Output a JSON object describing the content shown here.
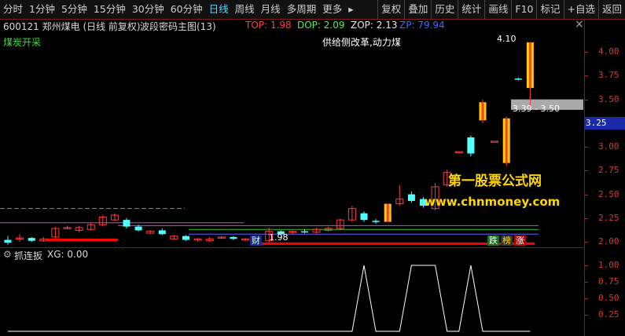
{
  "toolbar": {
    "periods": [
      "分时",
      "1分钟",
      "5分钟",
      "15分钟",
      "30分钟",
      "60分钟",
      "日线",
      "周线",
      "月线",
      "多周期",
      "更多"
    ],
    "active_period": "日线",
    "more_arrow": "▸",
    "actions": [
      "复权",
      "叠加",
      "历史",
      "统计",
      "画线",
      "F10",
      "标记",
      "+自选",
      "返回"
    ]
  },
  "header": {
    "stock": "600121 郑州煤电 (日线 前复权)",
    "indicator": "波段密码主图(13)",
    "top": "TOP: 1.98",
    "dop": "DOP: 2.09",
    "zop": "ZOP: 2.13",
    "zp": "ZP: 79.94"
  },
  "annotations": {
    "sector": "煤炭开采",
    "concept": "供给侧改革,动力煤",
    "high_label": "4.10",
    "low_label": "1.98",
    "range_label": "3.39 - 3.50",
    "cai_badge": "财",
    "die_badge": "跌",
    "bang_badge": "榜",
    "zhang_badge": "涨"
  },
  "watermark": {
    "line1": "第一股票公式网",
    "line2": "www.chnmoney.com"
  },
  "right_axis": {
    "ticks": [
      "4.00",
      "3.75",
      "3.50",
      "3.25",
      "3.00",
      "2.75",
      "2.50",
      "2.25",
      "2.00"
    ],
    "price_tag": "3.25"
  },
  "subchart": {
    "title": "抓连扳",
    "xg": "XG: 0.00",
    "ticks": [
      "1.00",
      "0.75",
      "0.50",
      "0.25"
    ]
  },
  "colors": {
    "up": "#ff3b3b",
    "down": "#54ffff",
    "limit_up": "#ffcc00",
    "support": "#ff0000"
  },
  "chart_data": {
    "type": "candlestick",
    "ylim": [
      1.95,
      4.2
    ],
    "candles": [
      [
        2.02,
        1.99,
        2.06,
        1.97
      ],
      [
        2.03,
        2.04,
        2.08,
        2.0
      ],
      [
        2.04,
        2.01,
        2.05,
        2.0
      ],
      [
        2.01,
        2.03,
        2.05,
        2.0
      ],
      [
        2.05,
        2.14,
        2.16,
        2.03
      ],
      [
        2.14,
        2.15,
        2.17,
        2.13
      ],
      [
        2.12,
        2.15,
        2.17,
        2.1
      ],
      [
        2.13,
        2.18,
        2.2,
        2.12
      ],
      [
        2.18,
        2.26,
        2.28,
        2.16
      ],
      [
        2.23,
        2.28,
        2.3,
        2.22
      ],
      [
        2.23,
        2.16,
        2.25,
        2.14
      ],
      [
        2.16,
        2.12,
        2.18,
        2.11
      ],
      [
        2.09,
        2.11,
        2.12,
        2.08
      ],
      [
        2.12,
        2.08,
        2.14,
        2.07
      ],
      [
        2.03,
        2.06,
        2.07,
        2.02
      ],
      [
        2.06,
        2.02,
        2.07,
        2.01
      ],
      [
        2.02,
        2.03,
        2.04,
        2.0
      ],
      [
        2.01,
        2.03,
        2.05,
        2.0
      ],
      [
        2.04,
        2.05,
        2.06,
        2.03
      ],
      [
        2.05,
        2.03,
        2.06,
        2.02
      ],
      [
        2.02,
        2.03,
        2.04,
        2.01
      ],
      [
        2.02,
        2.03,
        2.04,
        2.0
      ],
      [
        2.01,
        2.11,
        2.15,
        1.99
      ],
      [
        2.11,
        2.08,
        2.12,
        2.07
      ],
      [
        2.1,
        2.11,
        2.12,
        2.08
      ],
      [
        2.11,
        2.1,
        2.13,
        2.09
      ],
      [
        2.1,
        2.13,
        2.15,
        2.09
      ],
      [
        2.12,
        2.14,
        2.16,
        2.11
      ],
      [
        2.14,
        2.23,
        2.24,
        2.12
      ],
      [
        2.23,
        2.35,
        2.38,
        2.21
      ],
      [
        2.3,
        2.23,
        2.32,
        2.21
      ],
      [
        2.22,
        2.21,
        2.24,
        2.19
      ],
      [
        2.21,
        2.4,
        2.4,
        2.21
      ],
      [
        2.4,
        2.45,
        2.6,
        2.38
      ],
      [
        2.5,
        2.43,
        2.53,
        2.41
      ],
      [
        2.45,
        2.38,
        2.47,
        2.36
      ],
      [
        2.35,
        2.58,
        2.62,
        2.33
      ],
      [
        2.6,
        2.73,
        2.76,
        2.58
      ],
      [
        2.95,
        2.95,
        2.95,
        2.95
      ],
      [
        3.1,
        2.93,
        3.12,
        2.9
      ],
      [
        3.28,
        3.47,
        3.5,
        3.25
      ],
      [
        3.06,
        3.06,
        3.06,
        3.06
      ],
      [
        2.83,
        3.3,
        3.32,
        2.8
      ],
      [
        3.72,
        3.71,
        3.73,
        3.7
      ],
      [
        3.62,
        4.1,
        4.1,
        3.39
      ]
    ],
    "limit_up_indices": [
      32,
      40,
      42,
      44
    ],
    "support_line": 1.98,
    "signal": [
      0,
      0,
      0,
      0,
      0,
      0,
      0,
      0,
      0,
      0,
      0,
      0,
      0,
      0,
      0,
      0,
      0,
      0,
      0,
      0,
      0,
      0,
      0,
      0,
      0,
      0,
      0,
      0,
      0,
      0,
      1,
      0,
      0,
      0,
      1,
      1,
      1,
      0,
      0,
      1,
      0,
      0,
      0,
      0,
      0
    ]
  }
}
